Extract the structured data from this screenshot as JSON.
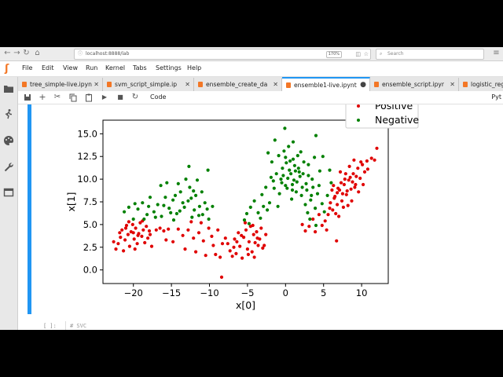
{
  "browser": {
    "url": "localhost:8888/lab",
    "zoom": "170%",
    "search_placeholder": "Search"
  },
  "menu": {
    "items": [
      "File",
      "Edit",
      "View",
      "Run",
      "Kernel",
      "Tabs",
      "Settings",
      "Help"
    ]
  },
  "tabs": [
    {
      "label": "tree_simple-live.ipyn",
      "active": false,
      "close": "✕"
    },
    {
      "label": "svm_script_simple.ip",
      "active": false,
      "close": "✕"
    },
    {
      "label": "ensemble_create_da",
      "active": false,
      "close": "✕"
    },
    {
      "label": "ensemble1-live.ipynt",
      "active": true,
      "close": "●"
    },
    {
      "label": "ensemble_script.ipyr",
      "active": false,
      "close": "✕"
    },
    {
      "label": "logistic_reg",
      "active": false,
      "close": ""
    }
  ],
  "toolbar": {
    "cell_type": "Code",
    "kernel": "Pyt"
  },
  "next_cell": {
    "prompt": "[ ]:",
    "code": "# SVC"
  },
  "colors": {
    "positive": "#e00000",
    "negative": "#008000",
    "accent": "#2196f3",
    "jupyter_orange": "#f37726"
  },
  "chart_data": {
    "type": "scatter",
    "xlabel": "x[0]",
    "ylabel": "x[1]",
    "xlim": [
      -24,
      13.5
    ],
    "ylim": [
      -1.5,
      16.5
    ],
    "xticks": [
      -20,
      -15,
      -10,
      -5,
      0,
      5,
      10
    ],
    "yticks": [
      0.0,
      2.5,
      5.0,
      7.5,
      10.0,
      12.5,
      15.0
    ],
    "xtick_labels": [
      "−20",
      "−15",
      "−10",
      "−5",
      "0",
      "5",
      "10"
    ],
    "ytick_labels": [
      "0.0",
      "2.5",
      "5.0",
      "7.5",
      "10.0",
      "12.5",
      "15.0"
    ],
    "legend": [
      "Positive",
      "Negative"
    ],
    "grid": false,
    "legend_position": "top-right",
    "series": [
      {
        "name": "Positive",
        "color": "#e00000",
        "points": [
          [
            -22.3,
            2.3
          ],
          [
            -22.0,
            2.9
          ],
          [
            -21.7,
            3.6
          ],
          [
            -21.5,
            4.4
          ],
          [
            -21.3,
            2.1
          ],
          [
            -21.1,
            3.3
          ],
          [
            -20.9,
            4.9
          ],
          [
            -20.7,
            3.9
          ],
          [
            -20.5,
            2.6
          ],
          [
            -20.3,
            4.2
          ],
          [
            -20.1,
            5.0
          ],
          [
            -19.9,
            3.4
          ],
          [
            -19.7,
            4.6
          ],
          [
            -19.5,
            2.9
          ],
          [
            -19.3,
            4.0
          ],
          [
            -19.1,
            5.2
          ],
          [
            -18.9,
            3.7
          ],
          [
            -18.7,
            4.4
          ],
          [
            -18.5,
            3.0
          ],
          [
            -18.3,
            4.8
          ],
          [
            -18.1,
            3.5
          ],
          [
            -17.9,
            4.3
          ],
          [
            -17.6,
            2.6
          ],
          [
            -21.8,
            4.1
          ],
          [
            -20.6,
            5.3
          ],
          [
            -19.8,
            2.3
          ],
          [
            -18.8,
            5.4
          ],
          [
            -17.8,
            3.9
          ],
          [
            -21.0,
            4.6
          ],
          [
            -19.4,
            3.8
          ],
          [
            -20.0,
            4.1
          ],
          [
            -22.6,
            3.1
          ],
          [
            -17.0,
            4.4
          ],
          [
            -16.5,
            4.6
          ],
          [
            -16.0,
            4.3
          ],
          [
            -15.4,
            4.5
          ],
          [
            -14.8,
            3.1
          ],
          [
            -14.1,
            4.5
          ],
          [
            -13.5,
            3.8
          ],
          [
            -12.8,
            4.4
          ],
          [
            -12.1,
            3.5
          ],
          [
            -11.4,
            4.1
          ],
          [
            -10.8,
            3.2
          ],
          [
            -10.1,
            4.6
          ],
          [
            -9.5,
            2.7
          ],
          [
            -8.9,
            4.4
          ],
          [
            -13.2,
            2.3
          ],
          [
            -11.8,
            2.0
          ],
          [
            -10.5,
            1.6
          ],
          [
            -12.4,
            5.3
          ],
          [
            -15.7,
            3.3
          ],
          [
            -9.7,
            3.7
          ],
          [
            -8.3,
            2.9
          ],
          [
            -11.1,
            5.2
          ],
          [
            -7.6,
            2.9
          ],
          [
            -7.3,
            2.1
          ],
          [
            -7.0,
            1.5
          ],
          [
            -6.7,
            3.4
          ],
          [
            -6.5,
            1.8
          ],
          [
            -6.2,
            4.1
          ],
          [
            -6.0,
            2.6
          ],
          [
            -5.7,
            1.3
          ],
          [
            -5.5,
            3.6
          ],
          [
            -5.2,
            4.4
          ],
          [
            -5.0,
            2.3
          ],
          [
            -4.8,
            3.1
          ],
          [
            -4.6,
            4.8
          ],
          [
            -4.4,
            2.0
          ],
          [
            -4.2,
            3.9
          ],
          [
            -4.0,
            3.0
          ],
          [
            -3.8,
            4.2
          ],
          [
            -3.6,
            2.7
          ],
          [
            -3.4,
            3.4
          ],
          [
            -3.2,
            4.6
          ],
          [
            -3.0,
            2.4
          ],
          [
            -5.8,
            3.8
          ],
          [
            -6.8,
            2.5
          ],
          [
            -4.9,
            1.7
          ],
          [
            -3.7,
            3.5
          ],
          [
            -5.3,
            5.2
          ],
          [
            -4.3,
            4.9
          ],
          [
            -6.4,
            3.1
          ],
          [
            -2.6,
            3.9
          ],
          [
            -7.9,
            3.5
          ],
          [
            -8.4,
            -0.8
          ],
          [
            -8.6,
            1.4
          ],
          [
            -4.1,
            1.4
          ],
          [
            -2.8,
            2.7
          ],
          [
            -9.2,
            1.7
          ],
          [
            2.2,
            5.0
          ],
          [
            2.6,
            4.3
          ],
          [
            3.1,
            4.8
          ],
          [
            3.6,
            5.6
          ],
          [
            3.9,
            4.2
          ],
          [
            4.4,
            6.1
          ],
          [
            4.8,
            4.9
          ],
          [
            5.2,
            5.4
          ],
          [
            5.6,
            6.1
          ],
          [
            5.9,
            7.4
          ],
          [
            6.2,
            6.6
          ],
          [
            6.5,
            8.1
          ],
          [
            6.8,
            7.2
          ],
          [
            7.1,
            8.8
          ],
          [
            7.4,
            7.6
          ],
          [
            7.7,
            9.4
          ],
          [
            8.0,
            8.3
          ],
          [
            8.3,
            9.9
          ],
          [
            8.6,
            8.9
          ],
          [
            8.9,
            10.6
          ],
          [
            9.2,
            9.4
          ],
          [
            9.5,
            11.2
          ],
          [
            9.8,
            10.1
          ],
          [
            10.1,
            11.6
          ],
          [
            10.4,
            10.8
          ],
          [
            10.7,
            12.0
          ],
          [
            7.9,
            10.6
          ],
          [
            8.4,
            11.4
          ],
          [
            9.0,
            12.1
          ],
          [
            7.3,
            9.6
          ],
          [
            6.9,
            9.0
          ],
          [
            6.4,
            7.9
          ],
          [
            8.7,
            7.6
          ],
          [
            9.6,
            8.6
          ],
          [
            10.2,
            9.4
          ],
          [
            7.6,
            6.9
          ],
          [
            6.6,
            6.2
          ],
          [
            5.8,
            6.8
          ],
          [
            6.1,
            8.8
          ],
          [
            7.0,
            5.9
          ],
          [
            8.2,
            7.1
          ],
          [
            9.3,
            10.3
          ],
          [
            10.8,
            11.1
          ],
          [
            11.3,
            12.3
          ],
          [
            6.7,
            3.2
          ],
          [
            5.4,
            4.4
          ],
          [
            7.8,
            10.0
          ],
          [
            8.8,
            9.7
          ],
          [
            11.7,
            12.1
          ],
          [
            12.0,
            13.4
          ],
          [
            6.3,
            9.3
          ],
          [
            7.2,
            10.8
          ],
          [
            9.9,
            11.9
          ],
          [
            8.1,
            8.7
          ],
          [
            7.5,
            8.4
          ],
          [
            6.8,
            8.5
          ],
          [
            9.1,
            9.1
          ],
          [
            8.5,
            10.2
          ]
        ]
      },
      {
        "name": "Negative",
        "color": "#008000",
        "points": [
          [
            -21.2,
            6.4
          ],
          [
            -20.6,
            6.9
          ],
          [
            -20.0,
            5.6
          ],
          [
            -19.4,
            6.7
          ],
          [
            -18.8,
            7.4
          ],
          [
            -18.2,
            6.1
          ],
          [
            -17.8,
            8.0
          ],
          [
            -17.3,
            6.4
          ],
          [
            -16.8,
            7.2
          ],
          [
            -16.3,
            5.9
          ],
          [
            -15.8,
            8.0
          ],
          [
            -15.3,
            6.8
          ],
          [
            -14.8,
            7.7
          ],
          [
            -14.3,
            6.2
          ],
          [
            -13.8,
            8.6
          ],
          [
            -13.3,
            6.9
          ],
          [
            -12.8,
            7.6
          ],
          [
            -12.3,
            5.8
          ],
          [
            -11.8,
            8.2
          ],
          [
            -11.3,
            7.0
          ],
          [
            -10.9,
            6.1
          ],
          [
            -10.3,
            6.7
          ],
          [
            -10.1,
            5.6
          ],
          [
            -14.1,
            9.5
          ],
          [
            -12.6,
            9.1
          ],
          [
            -13.1,
            10.0
          ],
          [
            -15.6,
            9.6
          ],
          [
            -12.1,
            8.7
          ],
          [
            -16.4,
            9.3
          ],
          [
            -11.6,
            9.9
          ],
          [
            -14.7,
            5.5
          ],
          [
            -17.1,
            5.8
          ],
          [
            -19.8,
            7.3
          ],
          [
            -18.6,
            5.6
          ],
          [
            -13.5,
            7.4
          ],
          [
            -12.0,
            6.6
          ],
          [
            -15.1,
            6.3
          ],
          [
            -11.0,
            8.6
          ],
          [
            -10.6,
            7.4
          ],
          [
            -16.0,
            7.1
          ],
          [
            -13.9,
            6.5
          ],
          [
            -12.4,
            7.9
          ],
          [
            -18.0,
            7.0
          ],
          [
            -14.5,
            8.2
          ],
          [
            -11.4,
            6.0
          ],
          [
            -9.6,
            7.0
          ],
          [
            -10.2,
            11.0
          ],
          [
            -12.7,
            11.4
          ],
          [
            -5.4,
            5.5
          ],
          [
            -5.1,
            6.2
          ],
          [
            -4.6,
            6.9
          ],
          [
            -4.1,
            7.6
          ],
          [
            -3.6,
            6.3
          ],
          [
            -3.1,
            8.3
          ],
          [
            -2.6,
            9.1
          ],
          [
            -2.1,
            7.4
          ],
          [
            -1.6,
            9.8
          ],
          [
            -1.2,
            10.6
          ],
          [
            -0.8,
            8.4
          ],
          [
            -0.4,
            11.2
          ],
          [
            0.0,
            9.3
          ],
          [
            0.3,
            10.1
          ],
          [
            0.6,
            12.0
          ],
          [
            0.9,
            8.8
          ],
          [
            1.2,
            11.5
          ],
          [
            1.5,
            9.7
          ],
          [
            1.8,
            10.8
          ],
          [
            2.1,
            8.2
          ],
          [
            2.4,
            11.9
          ],
          [
            2.7,
            9.5
          ],
          [
            3.0,
            10.4
          ],
          [
            3.3,
            7.7
          ],
          [
            3.6,
            9.1
          ],
          [
            3.9,
            6.8
          ],
          [
            4.2,
            8.4
          ],
          [
            4.5,
            10.9
          ],
          [
            4.8,
            7.3
          ],
          [
            5.1,
            6.4
          ],
          [
            -1.8,
            11.9
          ],
          [
            -0.2,
            13.1
          ],
          [
            0.4,
            13.6
          ],
          [
            1.0,
            14.1
          ],
          [
            2.0,
            13.0
          ],
          [
            3.0,
            11.6
          ],
          [
            -0.6,
            10.0
          ],
          [
            0.2,
            9.0
          ],
          [
            1.4,
            8.6
          ],
          [
            0.8,
            7.8
          ],
          [
            -1.0,
            7.0
          ],
          [
            -2.4,
            6.6
          ],
          [
            2.6,
            7.2
          ],
          [
            3.8,
            12.4
          ],
          [
            -0.1,
            15.6
          ],
          [
            -1.4,
            14.3
          ],
          [
            4.0,
            14.8
          ],
          [
            1.6,
            12.6
          ],
          [
            0.5,
            11.0
          ],
          [
            -0.3,
            10.4
          ],
          [
            0.1,
            11.8
          ],
          [
            1.1,
            9.9
          ],
          [
            1.9,
            10.3
          ],
          [
            -1.5,
            9.0
          ],
          [
            2.2,
            9.1
          ],
          [
            3.5,
            10.0
          ],
          [
            4.4,
            9.3
          ],
          [
            5.5,
            8.2
          ],
          [
            6.0,
            9.6
          ],
          [
            5.8,
            11.0
          ],
          [
            -3.3,
            5.7
          ],
          [
            -2.9,
            7.0
          ],
          [
            -4.8,
            5.1
          ],
          [
            2.9,
            6.3
          ],
          [
            3.2,
            5.6
          ],
          [
            4.0,
            4.9
          ],
          [
            -0.9,
            12.6
          ],
          [
            0.7,
            10.6
          ],
          [
            1.3,
            10.9
          ],
          [
            -0.5,
            9.6
          ],
          [
            0.9,
            9.4
          ],
          [
            1.7,
            11.2
          ],
          [
            2.3,
            10.6
          ],
          [
            -1.9,
            10.2
          ],
          [
            0.0,
            12.4
          ],
          [
            1.0,
            12.2
          ],
          [
            -2.3,
            12.9
          ],
          [
            4.9,
            12.5
          ],
          [
            2.8,
            8.8
          ],
          [
            3.4,
            8.2
          ]
        ]
      }
    ]
  }
}
